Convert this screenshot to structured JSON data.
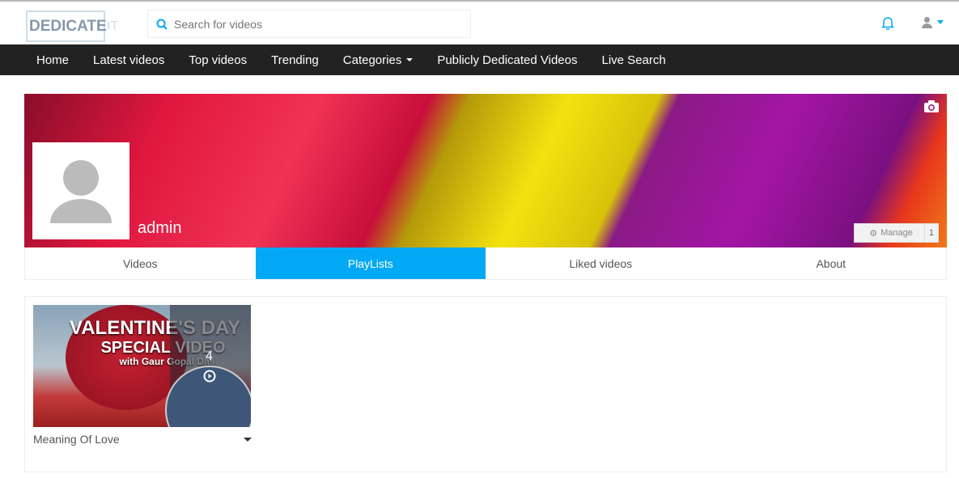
{
  "header": {
    "logo": "DEDICATE",
    "logo_suffix": "IT",
    "search_placeholder": "Search for videos"
  },
  "nav": [
    "Home",
    "Latest videos",
    "Top videos",
    "Trending",
    "Categories",
    "Publicly Dedicated Videos",
    "Live Search"
  ],
  "profile": {
    "username": "admin",
    "manage_label": "Manage",
    "manage_count": "1"
  },
  "tabs": [
    {
      "label": "Videos"
    },
    {
      "label": "PlayLists",
      "active": true
    },
    {
      "label": "Liked videos"
    },
    {
      "label": "About"
    }
  ],
  "playlists": [
    {
      "name": "Meaning Of Love",
      "count": "4",
      "thumb_title_1": "VALENTINE'S DAY",
      "thumb_title_2": "SPECIAL VIDEO",
      "thumb_title_3": "with Gaur Gopal Das"
    }
  ],
  "colors": {
    "accent": "#03a9f4",
    "nav_bg": "#222222"
  }
}
